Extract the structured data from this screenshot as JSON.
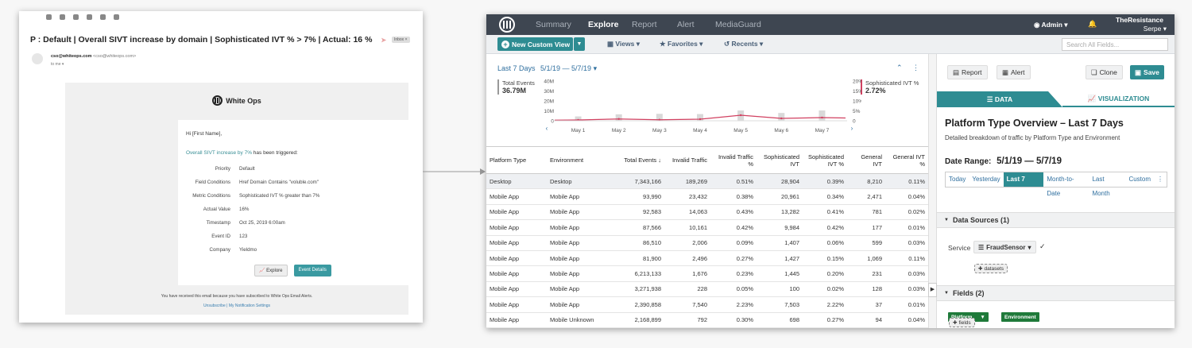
{
  "email": {
    "subject": "P : Default | Overall SIVT increase by domain | Sophisticated IVT % > 7% | Actual: 16 %",
    "inbox_tag": "Inbox ×",
    "sender_name": "cso@whiteops.com",
    "sender_addr": "<cso@whiteops.com>",
    "to_me": "to me ▾",
    "logo_text": "White Ops",
    "greeting": "Hi [First Name],",
    "trigger_link": "Overall SIVT increase by 7%",
    "trigger_rest": " has been triggered:",
    "fields": [
      {
        "label": "Priority",
        "value": "Default"
      },
      {
        "label": "Field Conditions",
        "value": "Href Domain Contains \"voluble.com\""
      },
      {
        "label": "Metric Conditions",
        "value": "Sophisticated IVT % greater than 7%"
      },
      {
        "label": "Actual Value",
        "value": "16%"
      },
      {
        "label": "Timestamp",
        "value": "Oct 25, 2019 6:00am"
      },
      {
        "label": "Event ID",
        "value": "123"
      },
      {
        "label": "Company",
        "value": "Yieldmo"
      }
    ],
    "explore_btn": "Explore",
    "event_details_btn": "Event Details",
    "footer_note": "You have received this email because you have subscribed to White Ops Email Alerts.",
    "unsubscribe": "Unsubscribe",
    "separator": " | ",
    "notification_settings": "My Notification Settings"
  },
  "app": {
    "nav": [
      "Summary",
      "Explore",
      "Report",
      "Alert",
      "MediaGuard"
    ],
    "active_nav": "Explore",
    "admin": "Admin ▾",
    "org_name": "TheResistance",
    "org_user": "Serpe ▾",
    "new_view_btn": "New Custom View",
    "subnav": [
      "Views ▾",
      "Favorites ▾",
      "Recents ▾"
    ],
    "search_placeholder": "Search All Fields...",
    "range_label": "Last 7 Days",
    "range_dates": "5/1/19 — 5/7/19",
    "left_metric": {
      "name": "Total Events",
      "value": "36.79M"
    },
    "right_metric": {
      "name": "Sophisticated IVT %",
      "value": "2.72%"
    }
  },
  "chart_data": {
    "type": "bar",
    "categories": [
      "May 1",
      "May 2",
      "May 3",
      "May 4",
      "May 5",
      "May 6",
      "May 7"
    ],
    "left_ticks": [
      "40M",
      "30M",
      "20M",
      "10M",
      "0"
    ],
    "right_ticks": [
      "20%",
      "15%",
      "10%",
      "5%",
      "0"
    ],
    "series": [
      {
        "name": "Total Events",
        "axis": "left",
        "values": [
          3.5,
          5.2,
          5.6,
          5.4,
          8.3,
          6.3,
          8.3
        ]
      },
      {
        "name": "Sophisticated IVT %",
        "axis": "right",
        "values": [
          0.4,
          0.9,
          0.5,
          0.8,
          2.8,
          1.2,
          1.6
        ]
      }
    ],
    "ylim_left": [
      0,
      40
    ],
    "ylim_right": [
      0,
      20
    ],
    "colors": {
      "bars": "#d9d9d9",
      "line": "#d14060"
    }
  },
  "table": {
    "columns": [
      "Platform Type",
      "Environment",
      "Total Events ↓",
      "Invalid Traffic",
      "Invalid Traffic %",
      "Sophisticated IVT",
      "Sophisticated IVT %",
      "General IVT",
      "General IVT %"
    ],
    "rows": [
      [
        "Desktop",
        "Desktop",
        "7,343,166",
        "189,269",
        "0.51%",
        "28,904",
        "0.39%",
        "8,210",
        "0.11%"
      ],
      [
        "Mobile App",
        "Mobile App",
        "93,990",
        "23,432",
        "0.38%",
        "20,961",
        "0.34%",
        "2,471",
        "0.04%"
      ],
      [
        "Mobile App",
        "Mobile App",
        "92,583",
        "14,063",
        "0.43%",
        "13,282",
        "0.41%",
        "781",
        "0.02%"
      ],
      [
        "Mobile App",
        "Mobile App",
        "87,566",
        "10,161",
        "0.42%",
        "9,984",
        "0.42%",
        "177",
        "0.01%"
      ],
      [
        "Mobile App",
        "Mobile App",
        "86,510",
        "2,006",
        "0.09%",
        "1,407",
        "0.06%",
        "599",
        "0.03%"
      ],
      [
        "Mobile App",
        "Mobile App",
        "81,900",
        "2,496",
        "0.27%",
        "1,427",
        "0.15%",
        "1,069",
        "0.11%"
      ],
      [
        "Mobile App",
        "Mobile App",
        "6,213,133",
        "1,676",
        "0.23%",
        "1,445",
        "0.20%",
        "231",
        "0.03%"
      ],
      [
        "Mobile App",
        "Mobile App",
        "3,271,938",
        "228",
        "0.05%",
        "100",
        "0.02%",
        "128",
        "0.03%"
      ],
      [
        "Mobile App",
        "Mobile App",
        "2,390,858",
        "7,540",
        "2.23%",
        "7,503",
        "2.22%",
        "37",
        "0.01%"
      ],
      [
        "Mobile App",
        "Mobile Unknown",
        "2,168,899",
        "792",
        "0.30%",
        "698",
        "0.27%",
        "94",
        "0.04%"
      ]
    ]
  },
  "panel": {
    "report_btn": "Report",
    "alert_btn": "Alert",
    "clone_btn": "Clone",
    "save_btn": "Save",
    "tab_data": "DATA",
    "tab_viz": "VISUALIZATION",
    "title": "Platform Type Overview – Last 7 Days",
    "description": "Detailed breakdown of traffic by Platform Type and Environment",
    "date_range_label": "Date Range:",
    "date_range_value": "5/1/19 — 5/7/19",
    "ranges": [
      "Today",
      "Yesterday",
      "Last 7 Days",
      "Month-to-Date",
      "Last Month",
      "Custom"
    ],
    "active_range": "Last 7 Days",
    "data_sources": "Data Sources (1)",
    "service_label": "Service",
    "service_value": "FraudSensor",
    "datasets_btn": "datasets",
    "fields_header": "Fields (2)",
    "field_chips": [
      "Platform",
      "Environment"
    ],
    "fields_btn": "fields"
  }
}
